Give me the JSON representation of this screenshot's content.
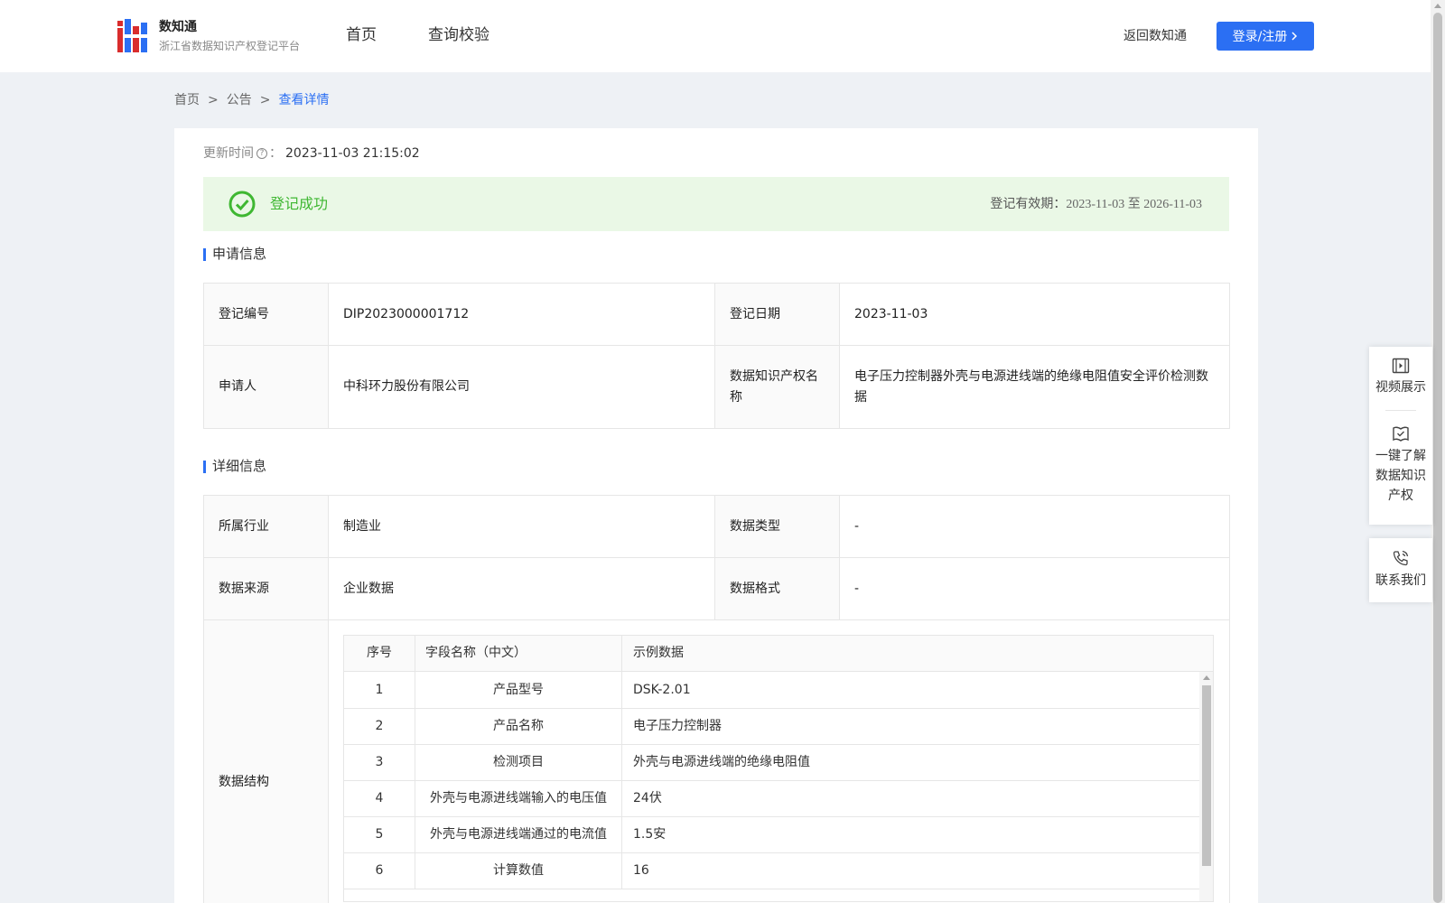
{
  "header": {
    "logo_title": "数知通",
    "logo_subtitle": "浙江省数据知识产权登记平台",
    "nav": [
      "首页",
      "查询校验"
    ],
    "back_link": "返回数知通",
    "login_button": "登录/注册",
    "brand_color": "#2b6ff3"
  },
  "breadcrumb": {
    "items": [
      "首页",
      "公告",
      "查看详情"
    ],
    "separator": ">"
  },
  "update": {
    "label": "更新时间",
    "help_icon": "question-circle-icon",
    "colon": "：",
    "value": "2023-11-03 21:15:02"
  },
  "status": {
    "icon": "check-circle-icon",
    "text": "登记成功",
    "color": "#3fb732",
    "validity_label": "登记有效期：",
    "validity_range": "2023-11-03 至 2026-11-03"
  },
  "application_info": {
    "title": "申请信息",
    "rows": [
      {
        "label1": "登记编号",
        "value1": "DIP2023000001712",
        "label2": "登记日期",
        "value2": "2023-11-03"
      },
      {
        "label1": "申请人",
        "value1": "中科环力股份有限公司",
        "label2": "数据知识产权名称",
        "value2": "电子压力控制器外壳与电源进线端的绝缘电阻值安全评价检测数据"
      }
    ]
  },
  "detail_info": {
    "title": "详细信息",
    "rows": [
      {
        "label1": "所属行业",
        "value1": "制造业",
        "label2": "数据类型",
        "value2": "-"
      },
      {
        "label1": "数据来源",
        "value1": "企业数据",
        "label2": "数据格式",
        "value2": "-"
      }
    ],
    "structure_label": "数据结构",
    "structure_table": {
      "headers": [
        "序号",
        "字段名称（中文）",
        "示例数据"
      ],
      "rows": [
        [
          "1",
          "产品型号",
          "DSK-2.01"
        ],
        [
          "2",
          "产品名称",
          "电子压力控制器"
        ],
        [
          "3",
          "检测项目",
          "外壳与电源进线端的绝缘电阻值"
        ],
        [
          "4",
          "外壳与电源进线端输入的电压值",
          "24伏"
        ],
        [
          "5",
          "外壳与电源进线端通过的电流值",
          "1.5安"
        ],
        [
          "6",
          "计算数值",
          "16"
        ]
      ]
    }
  },
  "side_panel": {
    "video": {
      "icon": "video-icon",
      "label": "视频展示"
    },
    "learn": {
      "icon": "book-icon",
      "label_lines": [
        "一键了解",
        "数据知识",
        "产权"
      ]
    },
    "contact": {
      "icon": "phone-icon",
      "label": "联系我们"
    }
  }
}
